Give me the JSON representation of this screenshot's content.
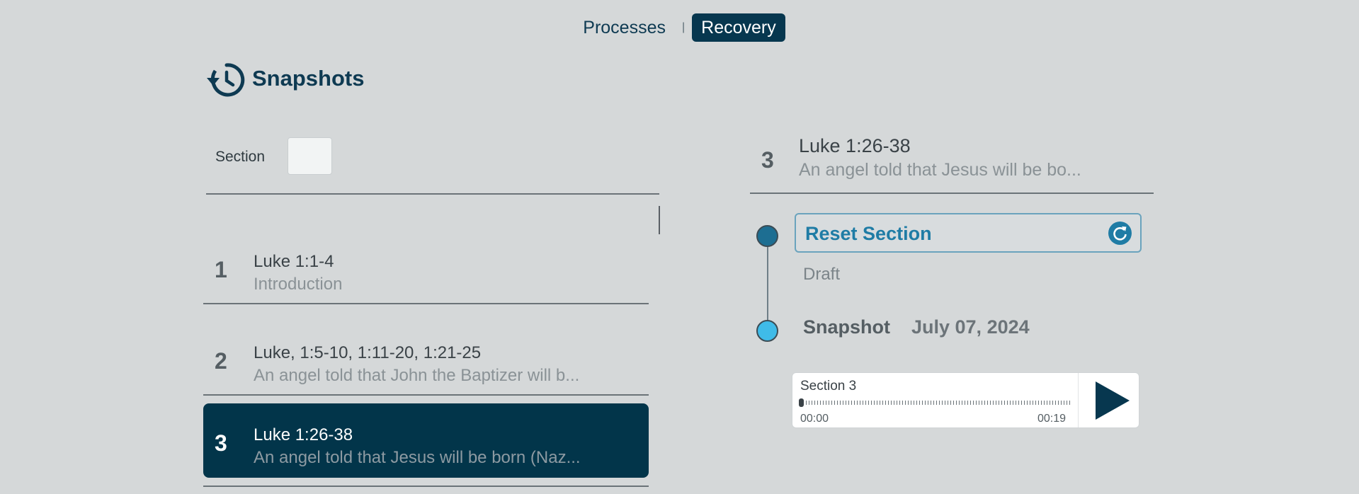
{
  "nav": {
    "tabs": [
      {
        "label": "Processes",
        "active": false
      },
      {
        "label": "Recovery",
        "active": true
      }
    ],
    "separator": "|"
  },
  "header": {
    "title": "Snapshots",
    "icon": "history-icon"
  },
  "filter": {
    "label": "Section",
    "value": ""
  },
  "sections": [
    {
      "number": "1",
      "title": "Luke 1:1-4",
      "subtitle": "Introduction"
    },
    {
      "number": "2",
      "title": "Luke, 1:5-10, 1:11-20, 1:21-25",
      "subtitle": "An angel told that John the Baptizer will b..."
    },
    {
      "number": "3",
      "title": "Luke 1:26-38",
      "subtitle": "An angel told that Jesus will be born (Naz...",
      "selected": true
    }
  ],
  "detail": {
    "number": "3",
    "title": "Luke 1:26-38",
    "subtitle": "An angel told that Jesus will be bo...",
    "reset_label": "Reset Section",
    "draft_label": "Draft",
    "snapshot_label": "Snapshot",
    "snapshot_date": "July 07, 2024",
    "player": {
      "title": "Section 3",
      "current_time": "00:00",
      "duration": "00:19",
      "progress": 0
    }
  },
  "colors": {
    "background": "#d5d8d9",
    "primary": "#07374f",
    "accent": "#1f7ca5",
    "dot_active": "#1d6e92",
    "dot_snapshot": "#3fbbe8"
  }
}
